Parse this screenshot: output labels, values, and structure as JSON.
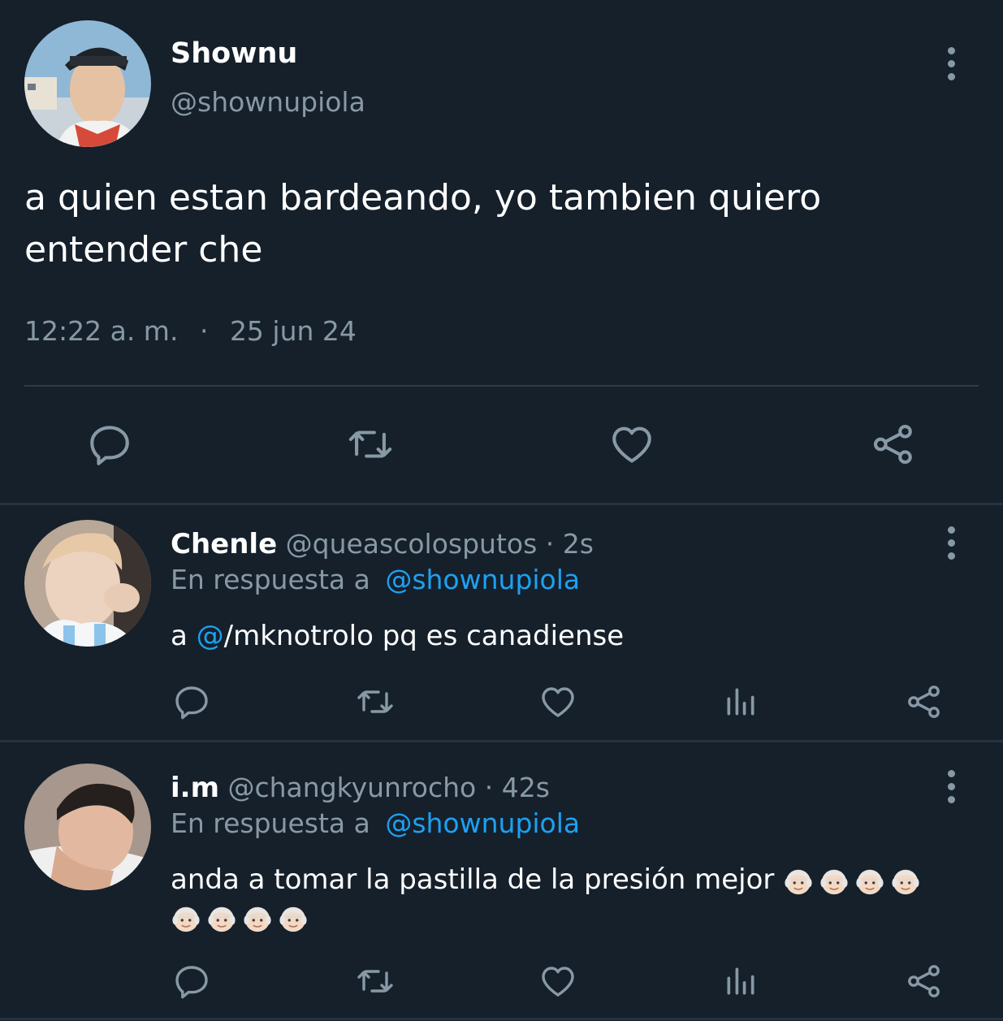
{
  "tweet": {
    "display_name": "Shownu",
    "handle": "@shownupiola",
    "text": "a quien estan bardeando, yo tambien quiero entender che",
    "time": "12:22 a. m.",
    "separator": "·",
    "date": "25 jun 24",
    "actions": [
      "reply-icon",
      "retweet-icon",
      "like-icon",
      "share-icon"
    ]
  },
  "replies": [
    {
      "display_name": "Chenle",
      "handle": "@queascolosputos",
      "age": "· 2s",
      "reply_prefix": "En respuesta a",
      "reply_to": "@shownupiola",
      "text_prefix": "a ",
      "text_mention": "@",
      "text_rest": "/mknotrolo pq es canadiense",
      "actions": [
        "reply-icon",
        "retweet-icon",
        "like-icon",
        "analytics-icon",
        "share-icon"
      ]
    },
    {
      "display_name": "i.m",
      "handle": "@changkyunrocho",
      "age": "· 42s",
      "reply_prefix": "En respuesta a",
      "reply_to": "@shownupiola",
      "text": "anda a tomar la pastilla de la presión mejor",
      "emoji": "older-man-emoji",
      "emoji_count": 8,
      "actions": [
        "reply-icon",
        "retweet-icon",
        "like-icon",
        "analytics-icon",
        "share-icon"
      ]
    }
  ],
  "colors": {
    "background": "#15202b",
    "divider": "#253341",
    "muted": "#8899a6",
    "link": "#1da1f2",
    "text": "#ffffff"
  }
}
